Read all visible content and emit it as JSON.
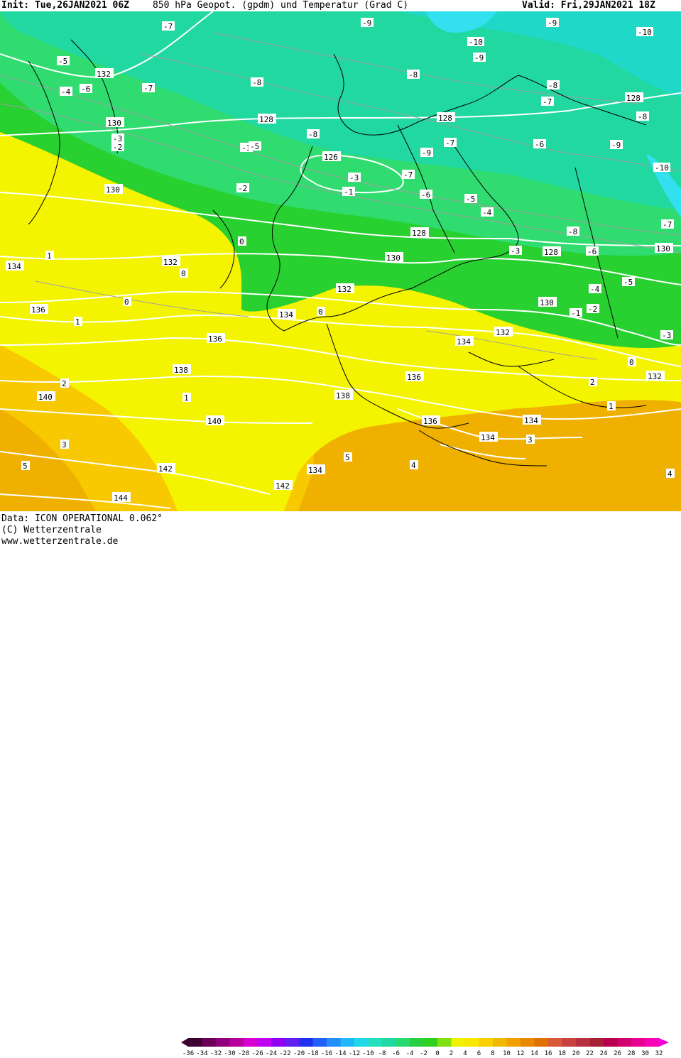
{
  "header": {
    "init": "Init: Tue,26JAN2021 06Z",
    "title": "850 hPa Geopot. (gpdm) und Temperatur (Grad C)",
    "valid": "Valid: Fri,29JAN2021 18Z"
  },
  "footer": {
    "data_source": "Data: ICON OPERATIONAL 0.062°",
    "copyright": "(C) Wetterzentrale",
    "url": "www.wetterzentrale.de"
  },
  "colors": {
    "deep_blue": "#33c8e0",
    "teal": "#20d8b0",
    "light_green": "#30dc70",
    "green": "#28d030",
    "yellow": "#f4f400",
    "light_orange": "#f8d000",
    "orange": "#f0b000",
    "isohypse": "#ffffff",
    "border": "#000000"
  },
  "legend": {
    "ticks": [
      "-36",
      "-34",
      "-32",
      "-30",
      "-28",
      "-26",
      "-24",
      "-22",
      "-20",
      "-18",
      "-16",
      "-14",
      "-12",
      "-10",
      "-8",
      "-6",
      "-4",
      "-2",
      "0",
      "2",
      "4",
      "6",
      "8",
      "10",
      "12",
      "14",
      "16",
      "18",
      "20",
      "22",
      "24",
      "26",
      "28",
      "30",
      "32"
    ],
    "swatches": [
      "#3c0030",
      "#6a0058",
      "#90007c",
      "#b800a0",
      "#d800d0",
      "#c000f0",
      "#9000f0",
      "#6020f0",
      "#2030f0",
      "#2060f8",
      "#2090f8",
      "#20b8f8",
      "#20d8e8",
      "#20e0c0",
      "#20d8a0",
      "#28d870",
      "#28d040",
      "#30d020",
      "#80e010",
      "#f0f000",
      "#f8e800",
      "#f8d000",
      "#f0b800",
      "#f0a000",
      "#e88800",
      "#e07000",
      "#d85838",
      "#c84040",
      "#b83040",
      "#a82038",
      "#b80050",
      "#d00070",
      "#e80090",
      "#f800b8",
      "#f000e0"
    ]
  },
  "isohypse_labels": [
    {
      "text": "132"
    },
    {
      "text": "130"
    },
    {
      "text": "128"
    },
    {
      "text": "126"
    },
    {
      "text": "128"
    },
    {
      "text": "128"
    },
    {
      "text": "130"
    },
    {
      "text": "132"
    },
    {
      "text": "134"
    },
    {
      "text": "136"
    },
    {
      "text": "138"
    },
    {
      "text": "140"
    },
    {
      "text": "142"
    },
    {
      "text": "144"
    },
    {
      "text": "134"
    },
    {
      "text": "136"
    },
    {
      "text": "138"
    },
    {
      "text": "140"
    },
    {
      "text": "142"
    },
    {
      "text": "132"
    },
    {
      "text": "130"
    },
    {
      "text": "128"
    },
    {
      "text": "130"
    },
    {
      "text": "132"
    },
    {
      "text": "134"
    },
    {
      "text": "136"
    },
    {
      "text": "134"
    },
    {
      "text": "132"
    },
    {
      "text": "130"
    },
    {
      "text": "128"
    },
    {
      "text": "134"
    },
    {
      "text": "136"
    },
    {
      "text": "134"
    },
    {
      "text": "132"
    }
  ],
  "temperature_labels": [
    {
      "text": "-7"
    },
    {
      "text": "-5"
    },
    {
      "text": "-6"
    },
    {
      "text": "-4"
    },
    {
      "text": "-7"
    },
    {
      "text": "-8"
    },
    {
      "text": "-9"
    },
    {
      "text": "-10"
    },
    {
      "text": "-9"
    },
    {
      "text": "-8"
    },
    {
      "text": "-9"
    },
    {
      "text": "-10"
    },
    {
      "text": "-8"
    },
    {
      "text": "-7"
    },
    {
      "text": "-8"
    },
    {
      "text": "-6"
    },
    {
      "text": "-9"
    },
    {
      "text": "-10"
    },
    {
      "text": "-7"
    },
    {
      "text": "-5"
    },
    {
      "text": "-4"
    },
    {
      "text": "-3"
    },
    {
      "text": "-2"
    },
    {
      "text": "-1"
    },
    {
      "text": "0"
    },
    {
      "text": "1"
    },
    {
      "text": "2"
    },
    {
      "text": "3"
    },
    {
      "text": "4"
    },
    {
      "text": "5"
    },
    {
      "text": "-6"
    },
    {
      "text": "-7"
    },
    {
      "text": "-9"
    },
    {
      "text": "-3"
    },
    {
      "text": "-8"
    },
    {
      "text": "-7"
    },
    {
      "text": "-5"
    },
    {
      "text": "-4"
    },
    {
      "text": "-3"
    },
    {
      "text": "-2"
    },
    {
      "text": "-1"
    },
    {
      "text": "0"
    },
    {
      "text": "0"
    },
    {
      "text": "0"
    },
    {
      "text": "0"
    },
    {
      "text": "1"
    },
    {
      "text": "1"
    },
    {
      "text": "1"
    },
    {
      "text": "2"
    },
    {
      "text": "3"
    },
    {
      "text": "3"
    },
    {
      "text": "4"
    },
    {
      "text": "5"
    },
    {
      "text": "-1"
    },
    {
      "text": "-2"
    },
    {
      "text": "-3"
    },
    {
      "text": "-8"
    },
    {
      "text": "-6"
    },
    {
      "text": "-5"
    },
    {
      "text": "-4"
    }
  ]
}
